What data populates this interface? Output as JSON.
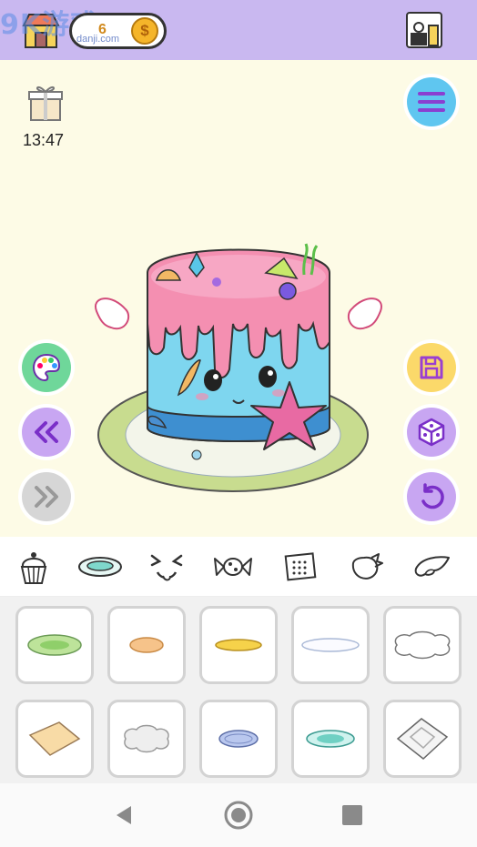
{
  "top_bar": {
    "watermark": "9K游戏",
    "watermark_sub": "danji.com",
    "coin_count": "6",
    "coin_symbol": "$",
    "shop_icon": "shop-icon",
    "kitchen_icon": "kitchen-icon"
  },
  "play_area": {
    "timer": "13:47",
    "gift_icon": "gift-icon",
    "left_tools": [
      "palette-icon",
      "rewind-icon",
      "fast-forward-icon"
    ],
    "right_tools": [
      "menu-icon",
      "save-icon",
      "dice-icon",
      "undo-icon"
    ]
  },
  "categories": [
    "cupcake-icon",
    "plate-icon",
    "face-icon",
    "candy-icon",
    "cracker-icon",
    "strawberry-icon",
    "wing-icon"
  ],
  "selected_category": "plate-icon",
  "items": [
    "green-plate",
    "orange-plate",
    "gold-plate",
    "white-plate",
    "cloud-plate",
    "tan-napkin",
    "grey-cloud-plate",
    "blue-plate",
    "teal-plate",
    "lace-napkin"
  ],
  "nav": [
    "back-icon",
    "home-icon",
    "recents-icon"
  ],
  "colors": {
    "top_bar": "#c9b8f0",
    "background": "#fdfbe6",
    "frosting": "#f48fb1",
    "cake_body": "#7ed6ef"
  }
}
